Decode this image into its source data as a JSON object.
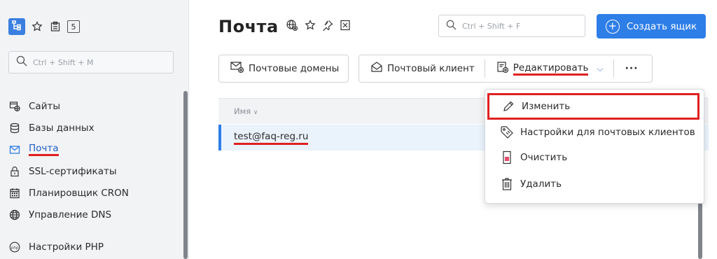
{
  "sidebar": {
    "top_count": "5",
    "search_placeholder": "Ctrl + Shift + M",
    "items": [
      {
        "label": "Сайты"
      },
      {
        "label": "Базы данных"
      },
      {
        "label": "Почта"
      },
      {
        "label": "SSL-сертификаты"
      },
      {
        "label": "Планировщик CRON"
      },
      {
        "label": "Управление DNS"
      },
      {
        "label": "Настройки PHP"
      }
    ]
  },
  "header": {
    "title": "Почта",
    "search_placeholder": "Ctrl + Shift + F",
    "create_label": "Создать ящик"
  },
  "toolbar": {
    "domains_label": "Почтовые домены",
    "client_label": "Почтовый клиент",
    "edit_label": "Редактировать",
    "more_label": "···"
  },
  "table": {
    "column_name": "Имя",
    "rows": [
      {
        "email": "test@faq-reg.ru"
      }
    ]
  },
  "dropdown": {
    "items": [
      {
        "label": "Изменить"
      },
      {
        "label": "Настройки для почтовых клиентов"
      },
      {
        "label": "Очистить"
      },
      {
        "label": "Удалить"
      }
    ]
  },
  "colors": {
    "accent": "#2e7ee8",
    "highlight": "#e02020",
    "sidebar_bg": "#f2f3f5",
    "selected_row_bg": "#eaf3fc"
  }
}
